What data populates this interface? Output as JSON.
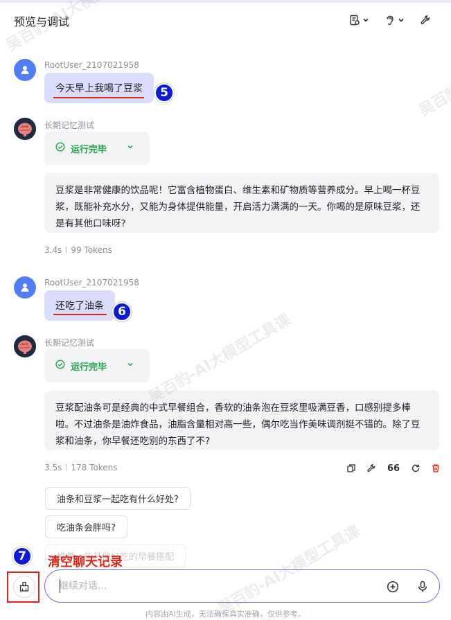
{
  "header": {
    "title": "预览与调试",
    "icons": [
      "doc-settings-icon",
      "ear-icon",
      "wrench-icon"
    ]
  },
  "messages": [
    {
      "role": "user",
      "sender": "RootUser_2107021958",
      "text": "今天早上我喝了豆浆",
      "badge": "5"
    },
    {
      "role": "bot",
      "sender": "长期记忆测试",
      "status": "运行完毕",
      "text": "豆浆是非常健康的饮品呢！它富含植物蛋白、维生素和矿物质等营养成分。早上喝一杯豆浆，既能补充水分，又能为身体提供能量，开启活力满满的一天。你喝的是原味豆浆，还是有其他口味呀?",
      "time": "3.4s",
      "tokens": "99 Tokens"
    },
    {
      "role": "user",
      "sender": "RootUser_2107021958",
      "text": "还吃了油条",
      "badge": "6"
    },
    {
      "role": "bot",
      "sender": "长期记忆测试",
      "status": "运行完毕",
      "text": "豆浆配油条可是经典的中式早餐组合，香软的油条泡在豆浆里吸满豆香，口感别提多棒啦。不过油条是油炸食品，油脂含量相对高一些，偶尔吃当作美味调剂挺不错的。除了豆浆和油条，你早餐还吃别的东西了不?",
      "time": "3.5s",
      "tokens": "178 Tokens"
    }
  ],
  "actions": {
    "quote_label": "66"
  },
  "suggestions": [
    "油条和豆浆一起吃有什么好处?",
    "吃油条会胖吗?",
    "推荐一些其他好吃的早餐搭配"
  ],
  "clear": {
    "badge": "7",
    "label": "清空聊天记录"
  },
  "input": {
    "placeholder": "继续对话..."
  },
  "footer": {
    "note": "内容由AI生成，无法确保真实准确，仅供参考。"
  },
  "watermark": {
    "text": "吴百豹-AI大模型工具课"
  },
  "colors": {
    "accent": "#6b6ef3",
    "user_bubble": "#d9dcfb",
    "success": "#1fa34a",
    "annotation_red": "#e0251b",
    "badge_blue": "#0b1ad8",
    "delete_red": "#e0251b"
  }
}
